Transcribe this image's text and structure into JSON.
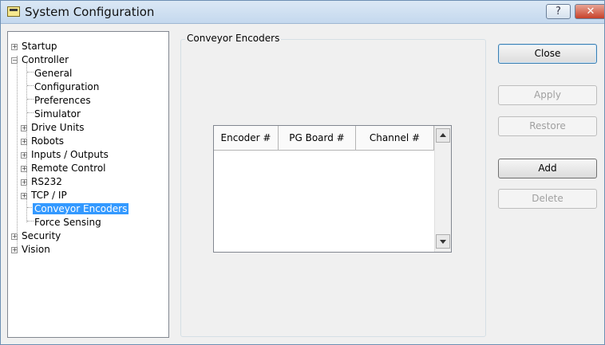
{
  "window": {
    "title": "System Configuration",
    "help_label": "?",
    "close_label": "✕"
  },
  "tree": {
    "items": [
      {
        "label": "Startup",
        "toggle": "+"
      },
      {
        "label": "Controller",
        "toggle": "−"
      },
      {
        "label": "General"
      },
      {
        "label": "Configuration"
      },
      {
        "label": "Preferences"
      },
      {
        "label": "Simulator"
      },
      {
        "label": "Drive Units",
        "toggle": "+"
      },
      {
        "label": "Robots",
        "toggle": "+"
      },
      {
        "label": "Inputs / Outputs",
        "toggle": "+"
      },
      {
        "label": "Remote Control",
        "toggle": "+"
      },
      {
        "label": "RS232",
        "toggle": "+"
      },
      {
        "label": "TCP / IP",
        "toggle": "+"
      },
      {
        "label": "Conveyor Encoders",
        "selected": true
      },
      {
        "label": "Force Sensing"
      },
      {
        "label": "Security",
        "toggle": "+"
      },
      {
        "label": "Vision",
        "toggle": "+"
      }
    ]
  },
  "panel": {
    "title": "Conveyor Encoders",
    "columns": [
      "Encoder #",
      "PG Board #",
      "Channel #"
    ]
  },
  "buttons": {
    "close": "Close",
    "apply": "Apply",
    "restore": "Restore",
    "add": "Add",
    "delete": "Delete"
  }
}
